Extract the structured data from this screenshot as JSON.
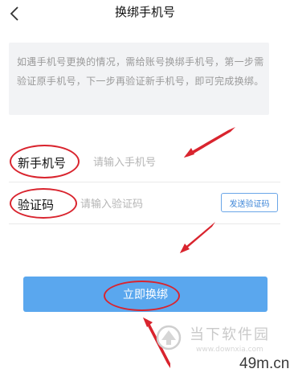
{
  "header": {
    "title": "换绑手机号",
    "back_icon": "back-arrow-icon"
  },
  "notice": {
    "text": "如遇手机号更换的情况，需给账号换绑手机号，第一步需验证原手机号，下一步再验证新手机号，即可完成换绑。"
  },
  "form": {
    "phone_label": "新手机号",
    "phone_placeholder": "请输入手机号",
    "code_label": "验证码",
    "code_placeholder": "请输入验证码",
    "send_code_label": "发送验证码"
  },
  "submit": {
    "label": "立即换绑"
  },
  "watermark": {
    "name": "当下软件园",
    "sub": "www.downxia.com",
    "site": "49m.cn"
  },
  "colors": {
    "accent": "#5aa7ee",
    "annotation_red": "#d9242e",
    "notice_bg": "#f2f3f5"
  }
}
